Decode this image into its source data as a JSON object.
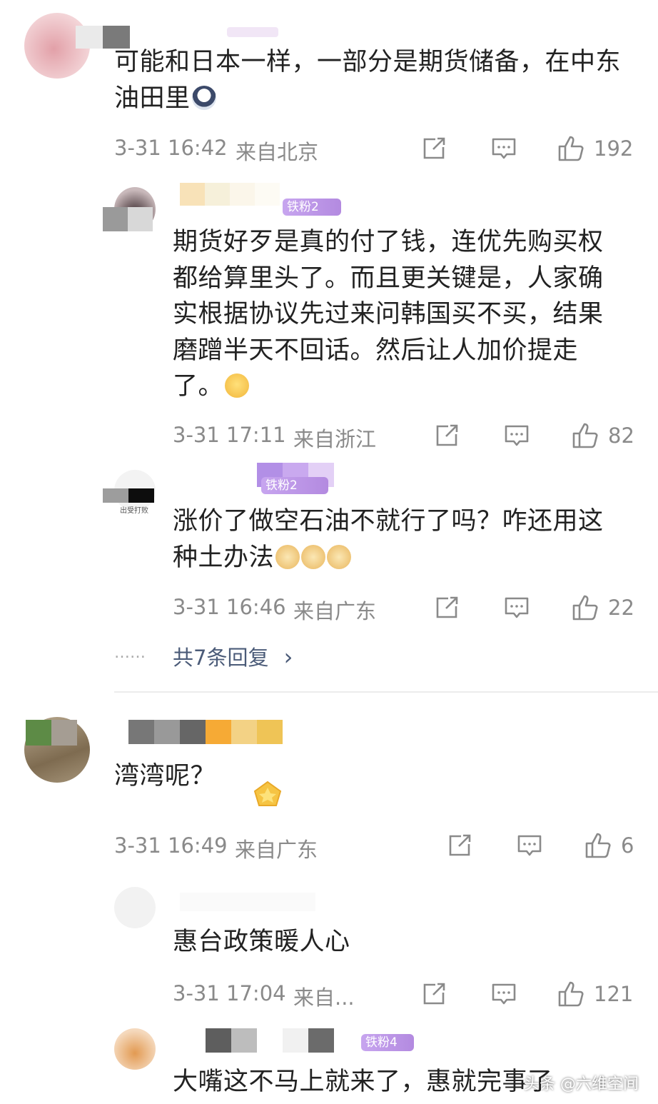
{
  "comments": [
    {
      "text": "可能和日本一样，一部分是期货储备，在中东油田里",
      "time": "3-31 16:42",
      "location": "来自北京",
      "likes": "192",
      "emoji": "face-emoji",
      "replies": [
        {
          "badge": "铁粉2",
          "text": "期货好歹是真的付了钱，连优先购买权都给算里头了。而且更关键是，人家确实根据协议先过来问韩国买不买，结果磨蹭半天不回话。然后让人加价提走了。",
          "emoji": "laugh-cry-emoji",
          "time": "3-31 17:11",
          "location": "来自浙江",
          "likes": "82"
        },
        {
          "badge": "铁粉2",
          "avatar_text": "出受打败",
          "text": "涨价了做空石油不就行了吗？咋还用这种土办法",
          "emoji": "doge-emoji",
          "time": "3-31 16:46",
          "location": "来自广东",
          "likes": "22"
        }
      ],
      "more_replies": "共7条回复"
    },
    {
      "text": "湾湾呢？",
      "time": "3-31 16:49",
      "location": "来自广东",
      "likes": "6",
      "replies": [
        {
          "text": "惠台政策暖人心",
          "time": "3-31 17:04",
          "location": "来自...",
          "likes": "121"
        },
        {
          "badge": "铁粉4",
          "text": "大嘴这不马上就来了，惠就完事了"
        }
      ]
    }
  ],
  "more_dots": "……",
  "chevron": "›",
  "watermark": "头条 @六维空间",
  "colors": {
    "meta_gray": "#8a8a8a",
    "link_blue": "#4b5b78",
    "emoji_yellow": "#f4c542"
  }
}
